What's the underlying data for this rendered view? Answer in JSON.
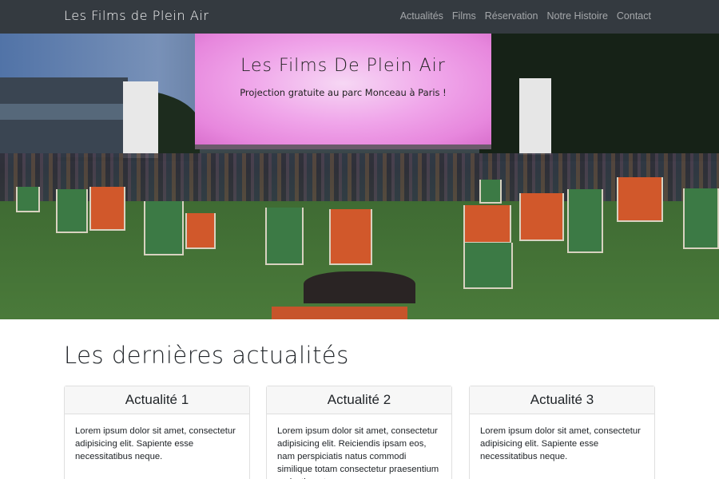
{
  "navbar": {
    "brand": "Les Films de Plein Air",
    "links": [
      "Actualités",
      "Films",
      "Réservation",
      "Notre Histoire",
      "Contact"
    ]
  },
  "hero": {
    "title": "Les Films De Plein Air",
    "subtitle": "Projection gratuite au parc Monceau à Paris !"
  },
  "news": {
    "title": "Les dernières actualités",
    "cards": [
      {
        "title": "Actualité 1",
        "text": "Lorem ipsum dolor sit amet, consectetur adipisicing elit. Sapiente esse necessitatibus neque."
      },
      {
        "title": "Actualité 2",
        "text": "Lorem ipsum dolor sit amet, consectetur adipisicing elit. Reiciendis ipsam eos, nam perspiciatis natus commodi similique totam consectetur praesentium molestiae atque"
      },
      {
        "title": "Actualité 3",
        "text": "Lorem ipsum dolor sit amet, consectetur adipisicing elit. Sapiente esse necessitatibus neque."
      }
    ]
  },
  "colors": {
    "navbar": "#343a40",
    "screen": "#f0a6ea",
    "lawn": "#4a7a3a"
  }
}
